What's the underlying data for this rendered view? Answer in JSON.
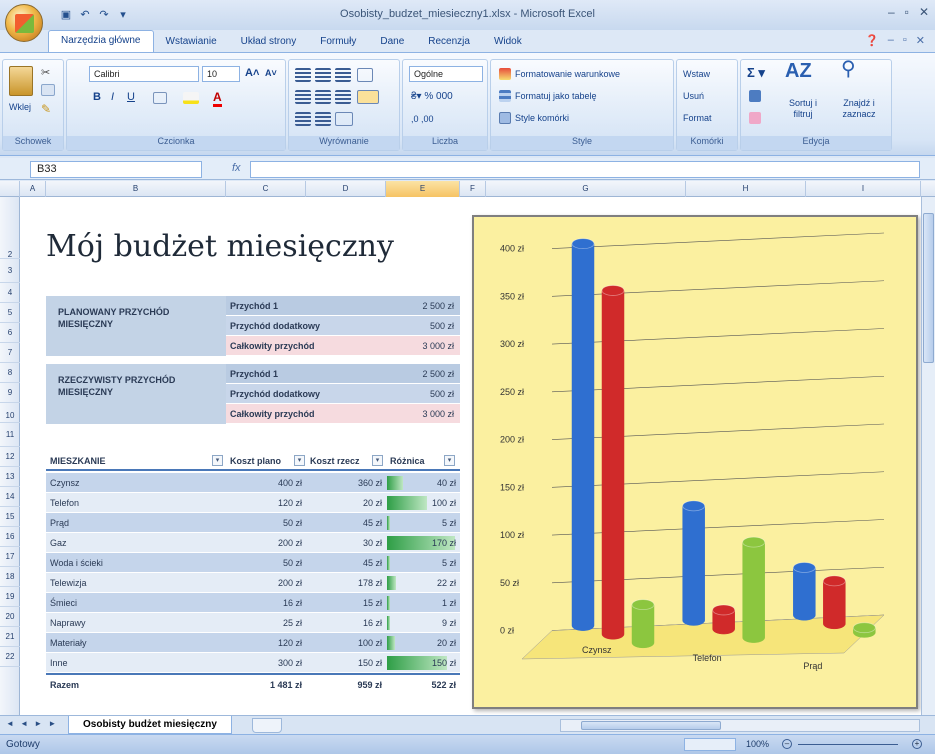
{
  "window": {
    "title": "Osobisty_budzet_miesieczny1.xlsx - Microsoft Excel"
  },
  "tabs": [
    "Narzędzia główne",
    "Wstawianie",
    "Układ strony",
    "Formuły",
    "Dane",
    "Recenzja",
    "Widok"
  ],
  "ribbon": {
    "clipboard": {
      "paste": "Wklej",
      "label": "Schowek"
    },
    "font": {
      "name": "Calibri",
      "size": "10",
      "label": "Czcionka"
    },
    "alignment": {
      "label": "Wyrównanie"
    },
    "number": {
      "format": "Ogólne",
      "label": "Liczba"
    },
    "styles": {
      "cond": "Formatowanie warunkowe",
      "table": "Formatuj jako tabelę",
      "cell": "Style komórki",
      "label": "Style"
    },
    "cells": {
      "insert": "Wstaw",
      "delete": "Usuń",
      "format": "Format",
      "label": "Komórki"
    },
    "editing": {
      "sort": "Sortuj i filtruj",
      "find": "Znajdź i zaznacz",
      "label": "Edycja"
    }
  },
  "formula_bar": {
    "name_box": "B33",
    "fx": "fx",
    "value": ""
  },
  "columns": [
    "A",
    "B",
    "C",
    "D",
    "E",
    "F",
    "G",
    "H",
    "I"
  ],
  "rows": [
    "2",
    "3",
    "4",
    "5",
    "6",
    "7",
    "8",
    "9",
    "10",
    "11",
    "12",
    "13",
    "14",
    "15",
    "16",
    "17",
    "18",
    "19",
    "20",
    "21",
    "22"
  ],
  "heading": "Mój budżet miesięczny",
  "planned_income": {
    "label": "PLANOWANY PRZYCHÓD MIESIĘCZNY",
    "rows": [
      {
        "name": "Przychód 1",
        "value": "2 500 zł"
      },
      {
        "name": "Przychód dodatkowy",
        "value": "500 zł"
      },
      {
        "name": "Całkowity przychód",
        "value": "3 000 zł"
      }
    ]
  },
  "actual_income": {
    "label": "RZECZYWISTY PRZYCHÓD MIESIĘCZNY",
    "rows": [
      {
        "name": "Przychód 1",
        "value": "2 500 zł"
      },
      {
        "name": "Przychód dodatkowy",
        "value": "500 zł"
      },
      {
        "name": "Całkowity przychód",
        "value": "3 000 zł"
      }
    ]
  },
  "housing_table": {
    "headers": [
      "MIESZKANIE",
      "Koszt plano",
      "Koszt rzecz",
      "Różnica"
    ],
    "rows": [
      {
        "name": "Czynsz",
        "planned": "400 zł",
        "actual": "360 zł",
        "diff": "40 zł",
        "bar": 0.24
      },
      {
        "name": "Telefon",
        "planned": "120 zł",
        "actual": "20 zł",
        "diff": "100 zł",
        "bar": 0.59
      },
      {
        "name": "Prąd",
        "planned": "50 zł",
        "actual": "45 zł",
        "diff": "5 zł",
        "bar": 0.03
      },
      {
        "name": "Gaz",
        "planned": "200 zł",
        "actual": "30 zł",
        "diff": "170 zł",
        "bar": 1.0
      },
      {
        "name": "Woda i ścieki",
        "planned": "50 zł",
        "actual": "45 zł",
        "diff": "5 zł",
        "bar": 0.03
      },
      {
        "name": "Telewizja",
        "planned": "200 zł",
        "actual": "178 zł",
        "diff": "22 zł",
        "bar": 0.13
      },
      {
        "name": "Śmieci",
        "planned": "16 zł",
        "actual": "15 zł",
        "diff": "1 zł",
        "bar": 0.01
      },
      {
        "name": "Naprawy",
        "planned": "25 zł",
        "actual": "16 zł",
        "diff": "9 zł",
        "bar": 0.05
      },
      {
        "name": "Materiały",
        "planned": "120 zł",
        "actual": "100 zł",
        "diff": "20 zł",
        "bar": 0.12
      },
      {
        "name": "Inne",
        "planned": "300 zł",
        "actual": "150 zł",
        "diff": "150 zł",
        "bar": 0.88
      }
    ],
    "total": {
      "name": "Razem",
      "planned": "1 481 zł",
      "actual": "959 zł",
      "diff": "522 zł"
    }
  },
  "chart_data": {
    "type": "bar",
    "categories": [
      "Czynsz",
      "Telefon",
      "Prąd"
    ],
    "series": [
      {
        "values": [
          400,
          120,
          50
        ],
        "color": "#2f6fd0"
      },
      {
        "values": [
          360,
          20,
          45
        ],
        "color": "#d02a2a"
      },
      {
        "values": [
          40,
          100,
          5
        ],
        "color": "#8cc63f"
      }
    ],
    "y_ticks": [
      "0 zł",
      "50 zł",
      "100 zł",
      "150 zł",
      "200 zł",
      "250 zł",
      "300 zł",
      "350 zł",
      "400 zł"
    ],
    "ylim": [
      0,
      400
    ],
    "grid": true,
    "background": "#fbf0a0"
  },
  "sheet": {
    "nav": "◄ ◄ ► ►",
    "active_tab": "Osobisty budżet miesięczny"
  },
  "status": {
    "text": "Gotowy",
    "zoom": "100%"
  }
}
